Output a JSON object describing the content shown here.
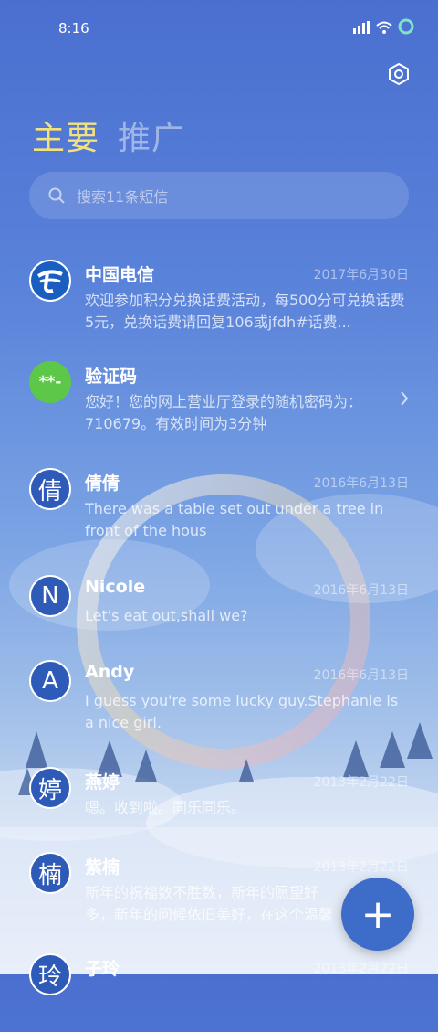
{
  "status_bar": {
    "time": "8:16"
  },
  "tabs": [
    {
      "label": "主要"
    },
    {
      "label": "推广"
    }
  ],
  "search": {
    "placeholder": "搜索11条短信"
  },
  "messages": [
    {
      "avatar": "",
      "name": "中国电信",
      "date": "2017年6月30日",
      "preview": "欢迎参加积分兑换话费活动，每500分可兑换话费5元，兑换话费请回复106或jfdh#话费..."
    },
    {
      "avatar": "**-",
      "name": "验证码",
      "date": "",
      "preview": "您好！您的网上营业厅登录的随机密码为：710679。有效时间为3分钟"
    },
    {
      "avatar": "倩",
      "name": "倩倩",
      "date": "2016年6月13日",
      "preview": "There was a table set out under a tree in front of the hous"
    },
    {
      "avatar": "N",
      "name": "Nicole",
      "date": "2016年6月13日",
      "preview": "Let's eat out,shall we?"
    },
    {
      "avatar": "A",
      "name": "Andy",
      "date": "2016年6月13日",
      "preview": "I guess you're some lucky guy.Stephanie is a nice girl."
    },
    {
      "avatar": "婷",
      "name": "燕婷",
      "date": "2013年2月22日",
      "preview": "嗯。收到啦。同乐同乐。"
    },
    {
      "avatar": "楠",
      "name": "紫楠",
      "date": "2013年2月22日",
      "preview": "新年的祝福数不胜数，新年的愿望好多，新年的问候依旧美好，在这个温馨的"
    },
    {
      "avatar": "玲",
      "name": "子玲",
      "date": "2013年2月22日",
      "preview": ""
    }
  ],
  "fab": {
    "label": "+"
  },
  "colors": {
    "active_tab": "#f3e27b",
    "telecom_blue": "#1a5fbf",
    "code_green": "#5cc748",
    "fab": "#3e6cc9"
  }
}
